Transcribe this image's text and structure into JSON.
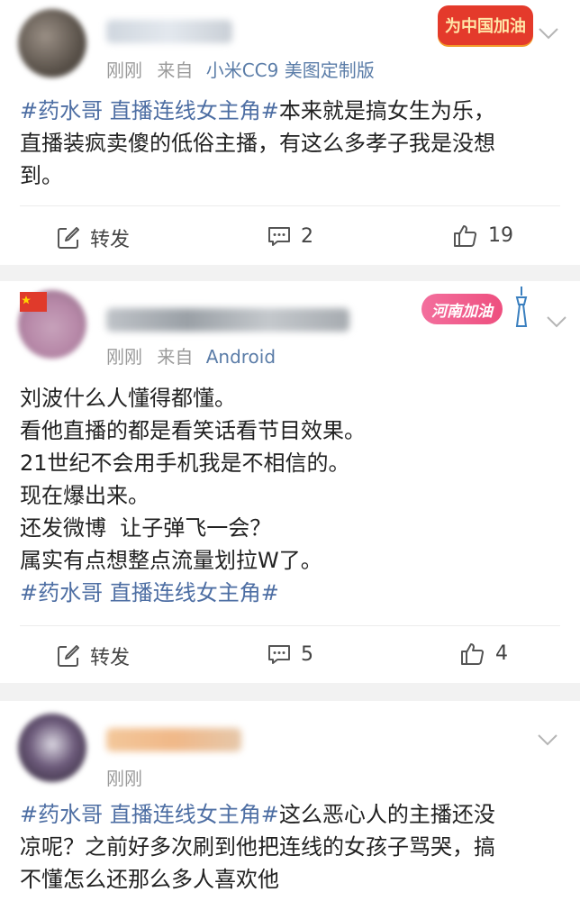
{
  "posts": [
    {
      "meta_time": "刚刚",
      "meta_from": "来自",
      "meta_source": "小米CC9 美图定制版",
      "badge_text": "为中国加油",
      "lines": [
        {
          "topic": "#药水哥 直播连线女主角#",
          "text": "本来就是搞女生为乐，"
        },
        {
          "topic": "",
          "text": "直播装疯卖傻的低俗主播，有这么多孝子我是没想"
        },
        {
          "topic": "",
          "text": "到。"
        }
      ],
      "repost_label": "转发",
      "comment_count": "2",
      "like_count": "19"
    },
    {
      "meta_time": "刚刚",
      "meta_from": "来自",
      "meta_source": "Android",
      "badge_text": "河南加油",
      "lines": [
        {
          "topic": "",
          "text": "刘波什么人懂得都懂。"
        },
        {
          "topic": "",
          "text": "看他直播的都是看笑话看节目效果。"
        },
        {
          "topic": "",
          "text": "21世纪不会用手机我是不相信的。"
        },
        {
          "topic": "",
          "text": "现在爆出来。"
        },
        {
          "topic": "",
          "text": "还发微博  让子弹飞一会？"
        },
        {
          "topic": "",
          "text": "属实有点想整点流量划拉W了。"
        },
        {
          "topic": "#药水哥 直播连线女主角#",
          "text": ""
        }
      ],
      "repost_label": "转发",
      "comment_count": "5",
      "like_count": "4"
    },
    {
      "meta_time": "刚刚",
      "lines": [
        {
          "topic": "#药水哥 直播连线女主角#",
          "text": "这么恶心人的主播还没"
        },
        {
          "topic": "",
          "text": "凉呢？之前好多次刷到他把连线的女孩子骂哭，搞"
        },
        {
          "topic": "",
          "text": "不懂怎么还那么多人喜欢他"
        }
      ]
    }
  ],
  "colors": {
    "topic": "#4d6ea3",
    "source": "#5b7da8",
    "meta": "#9a9a9a",
    "separator": "#f2f2f2"
  },
  "icons": [
    "repost-icon",
    "comment-icon",
    "like-icon",
    "chevron-down-icon"
  ]
}
